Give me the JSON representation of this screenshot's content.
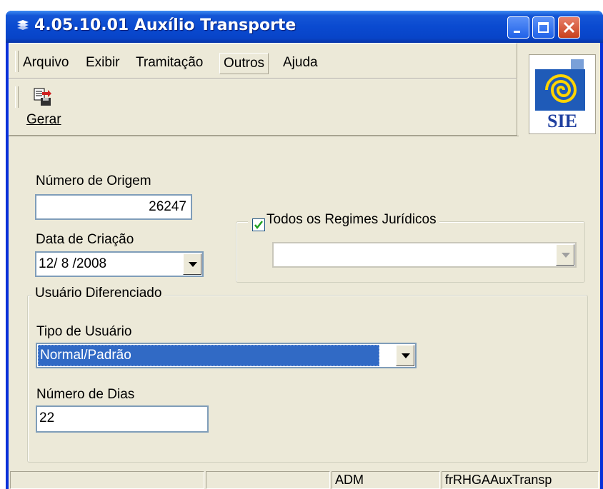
{
  "window": {
    "title": "4.05.10.01 Auxílio Transporte",
    "colors": {
      "titlebar": "#0a4ad0",
      "face": "#ece9d8",
      "selection": "#316ac5"
    }
  },
  "menu": {
    "items": [
      {
        "label": "Arquivo"
      },
      {
        "label": "Exibir"
      },
      {
        "label": "Tramitação"
      },
      {
        "label": "Outros"
      },
      {
        "label": "Ajuda"
      }
    ]
  },
  "toolbar": {
    "gerar_label": "Gerar",
    "gerar_icon": "generate-document-icon"
  },
  "logo": {
    "text": "SIE"
  },
  "form": {
    "numero_origem_label": "Número de Origem",
    "numero_origem_value": "26247",
    "data_criacao_label": "Data de Criação",
    "data_criacao_value": "12/ 8 /2008",
    "regimes_label": "Todos os Regimes Jurídicos",
    "regimes_checked": true,
    "regimes_value": "",
    "usuario_group_label": "Usuário Diferenciado",
    "tipo_usuario_label": "Tipo de Usuário",
    "tipo_usuario_value": "Normal/Padrão",
    "numero_dias_label": "Número de Dias",
    "numero_dias_value": "22"
  },
  "statusbar": {
    "panels": [
      "",
      "",
      "ADM",
      "frRHGAAuxTransp"
    ]
  }
}
